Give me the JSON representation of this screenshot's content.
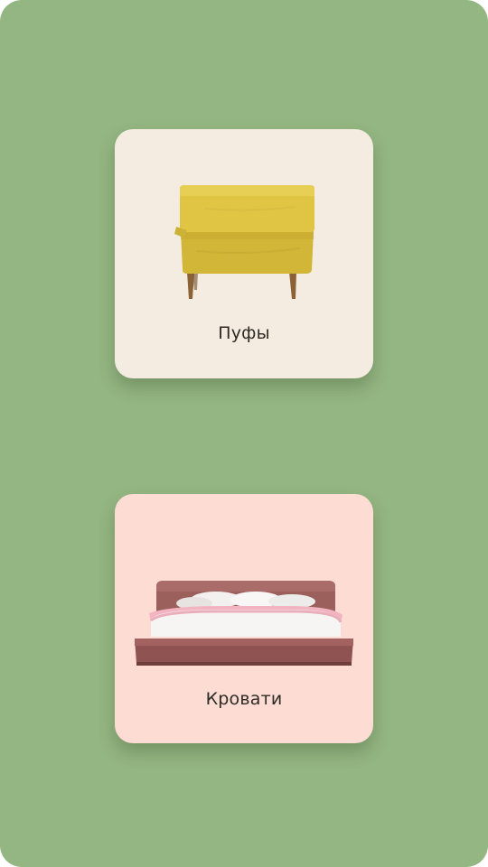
{
  "categories": [
    {
      "label": "Пуфы",
      "image_icon": "yellow-ottoman-image",
      "card_color": "#f4ece1",
      "product_color": "#dcc13e"
    },
    {
      "label": "Кровати",
      "image_icon": "upholstered-bed-image",
      "card_color": "#fddcd3",
      "product_color": "#9a5f5d"
    }
  ],
  "theme": {
    "background": "#94b682"
  }
}
